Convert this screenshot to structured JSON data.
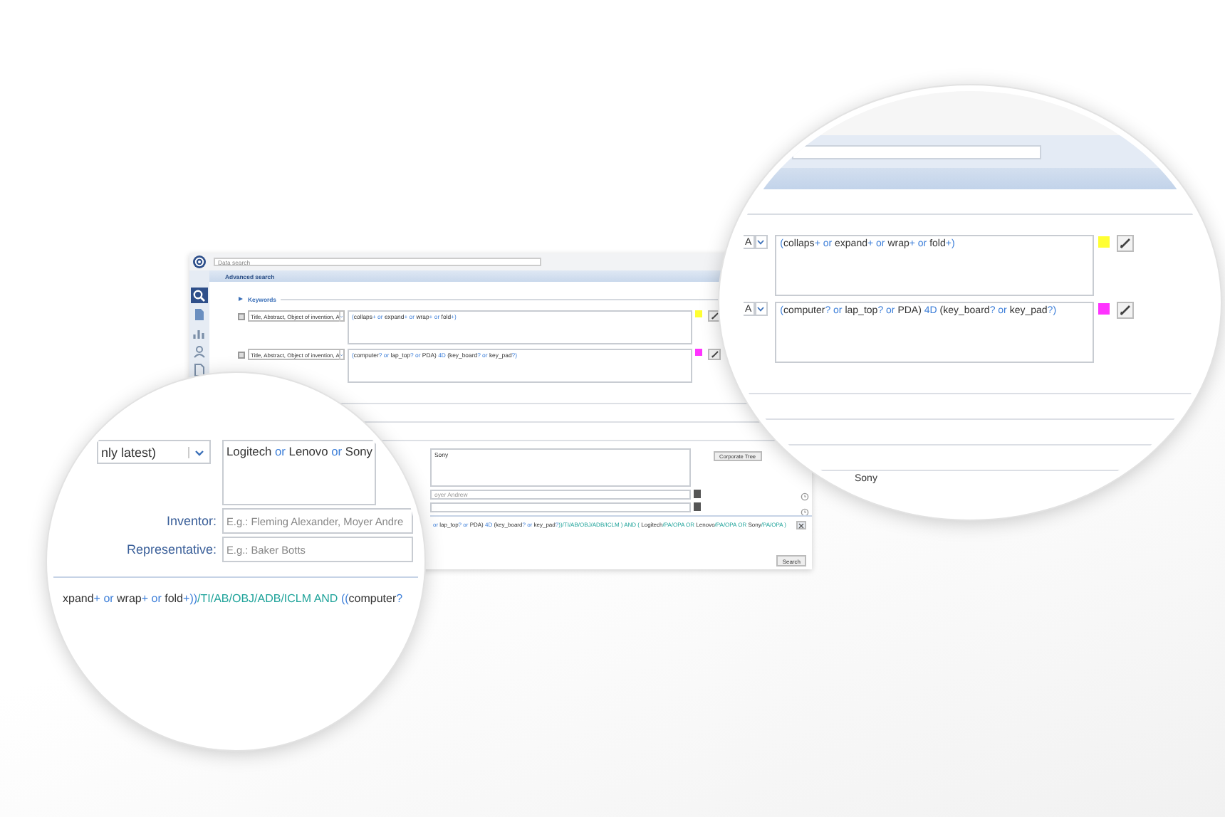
{
  "base_window": {
    "search_field": {
      "placeholder": "Data search"
    },
    "sidebar_items": [
      {
        "selected": true
      },
      {
        "selected": false
      },
      {
        "selected": false
      },
      {
        "selected": false
      },
      {
        "selected": false
      }
    ],
    "panel_title": "Advanced search",
    "section_label": "Keywords",
    "keyword_rows": [
      {
        "field": "Title, Abstract, Object of invention, A",
        "color": "#ffff33",
        "query": [
          {
            "kind": "op",
            "text": "("
          },
          {
            "kind": "term",
            "text": "collaps"
          },
          {
            "kind": "op",
            "text": "+ or "
          },
          {
            "kind": "term",
            "text": "expand"
          },
          {
            "kind": "op",
            "text": "+ or "
          },
          {
            "kind": "term",
            "text": "wrap"
          },
          {
            "kind": "op",
            "text": "+ or "
          },
          {
            "kind": "term",
            "text": "fold"
          },
          {
            "kind": "op",
            "text": "+)"
          }
        ]
      },
      {
        "field": "Title, Abstract, Object of invention, A",
        "color": "#ff33ff",
        "query": [
          {
            "kind": "op",
            "text": "("
          },
          {
            "kind": "term",
            "text": "computer"
          },
          {
            "kind": "op",
            "text": "? or "
          },
          {
            "kind": "term",
            "text": "lap_top"
          },
          {
            "kind": "op",
            "text": "? or "
          },
          {
            "kind": "term",
            "text": "PDA) "
          },
          {
            "kind": "op",
            "text": "4D "
          },
          {
            "kind": "term",
            "text": "(key_board"
          },
          {
            "kind": "op",
            "text": "? or "
          },
          {
            "kind": "term",
            "text": "key_pad"
          },
          {
            "kind": "op",
            "text": "?)"
          }
        ]
      }
    ],
    "assignee_query": [
      {
        "kind": "term",
        "text": "Sony"
      }
    ],
    "corporate_tree_button": "Corporate Tree",
    "inventor_field": {
      "placeholder": "oyer Andrew"
    },
    "query_preview": [
      {
        "kind": "op",
        "text": "or "
      },
      {
        "kind": "term",
        "text": "lap_top"
      },
      {
        "kind": "op",
        "text": "? or "
      },
      {
        "kind": "term",
        "text": "PDA) "
      },
      {
        "kind": "op",
        "text": "4D "
      },
      {
        "kind": "term",
        "text": "(key_board"
      },
      {
        "kind": "op",
        "text": "? or "
      },
      {
        "kind": "term",
        "text": "key_pad"
      },
      {
        "kind": "op",
        "text": "?"
      },
      {
        "kind": "field",
        "text": "))/TI/AB/OBJ/ADB/ICLM ) AND ( "
      },
      {
        "kind": "term",
        "text": "Logitech"
      },
      {
        "kind": "field",
        "text": "/PA/OPA OR "
      },
      {
        "kind": "term",
        "text": "Lenovo"
      },
      {
        "kind": "field",
        "text": "/PA/OPA OR "
      },
      {
        "kind": "term",
        "text": "Sony"
      },
      {
        "kind": "field",
        "text": "/PA/OPA )"
      }
    ],
    "search_button": "Search"
  },
  "left_magnifier": {
    "assignee_select": "nly latest)",
    "assignee_query": [
      {
        "kind": "term",
        "text": "Logitech"
      },
      {
        "kind": "op",
        "text": " or "
      },
      {
        "kind": "term",
        "text": "Lenovo"
      },
      {
        "kind": "op",
        "text": " or "
      },
      {
        "kind": "term",
        "text": "Sony"
      }
    ],
    "fields": [
      {
        "label": "Inventor:",
        "placeholder": "E.g.: Fleming Alexander, Moyer Andre"
      },
      {
        "label": "Representative:",
        "placeholder": "E.g.: Baker Botts"
      }
    ],
    "query_preview": [
      {
        "kind": "term",
        "text": "xpand"
      },
      {
        "kind": "op",
        "text": "+ or "
      },
      {
        "kind": "term",
        "text": "wrap"
      },
      {
        "kind": "op",
        "text": "+ or "
      },
      {
        "kind": "term",
        "text": "fold"
      },
      {
        "kind": "op",
        "text": "+))"
      },
      {
        "kind": "field",
        "text": "/TI/AB/OBJ/ADB/ICLM AND "
      },
      {
        "kind": "op",
        "text": "(("
      },
      {
        "kind": "term",
        "text": "computer"
      },
      {
        "kind": "op",
        "text": "?"
      }
    ]
  },
  "right_magnifier": {
    "keyword_rows": [
      {
        "field": "A",
        "color": "#ffff33",
        "query": [
          {
            "kind": "op",
            "text": "("
          },
          {
            "kind": "term",
            "text": "collaps"
          },
          {
            "kind": "op",
            "text": "+ or "
          },
          {
            "kind": "term",
            "text": "expand"
          },
          {
            "kind": "op",
            "text": "+ or "
          },
          {
            "kind": "term",
            "text": "wrap"
          },
          {
            "kind": "op",
            "text": "+ or "
          },
          {
            "kind": "term",
            "text": "fold"
          },
          {
            "kind": "op",
            "text": "+)"
          }
        ]
      },
      {
        "field": "A",
        "color": "#ff33ff",
        "query": [
          {
            "kind": "op",
            "text": "("
          },
          {
            "kind": "term",
            "text": "computer"
          },
          {
            "kind": "op",
            "text": "? or "
          },
          {
            "kind": "term",
            "text": "lap_top"
          },
          {
            "kind": "op",
            "text": "? or "
          },
          {
            "kind": "term",
            "text": "PDA) "
          },
          {
            "kind": "op",
            "text": "4D "
          },
          {
            "kind": "term",
            "text": "(key_board"
          },
          {
            "kind": "op",
            "text": "? or "
          },
          {
            "kind": "term",
            "text": "key_pad"
          },
          {
            "kind": "op",
            "text": "?)"
          }
        ]
      }
    ],
    "assignee_query": [
      {
        "kind": "term",
        "text": "Sony"
      }
    ]
  }
}
